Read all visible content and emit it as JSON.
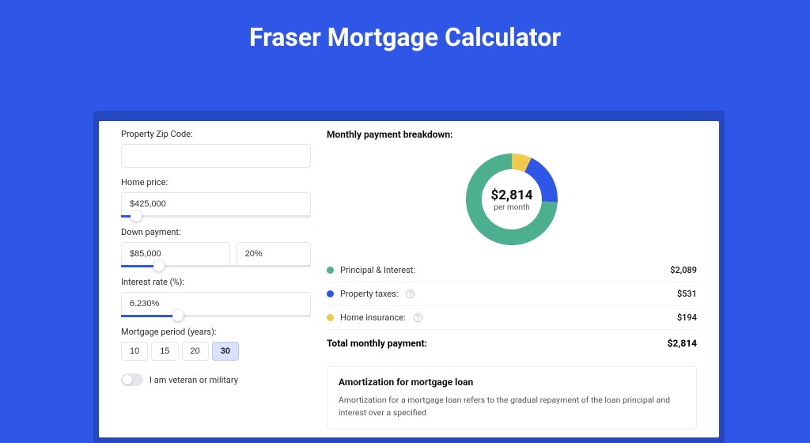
{
  "title": "Fraser Mortgage Calculator",
  "form": {
    "zip_label": "Property Zip Code:",
    "zip_value": "",
    "price_label": "Home price:",
    "price_value": "$425,000",
    "price_slider_pct": 8,
    "down_label": "Down payment:",
    "down_value": "$85,000",
    "down_pct_value": "20%",
    "down_slider_pct": 20,
    "rate_label": "Interest rate (%):",
    "rate_value": "6.230%",
    "rate_slider_pct": 30,
    "period_label": "Mortgage period (years):",
    "periods": [
      "10",
      "15",
      "20",
      "30"
    ],
    "period_active_index": 3,
    "veteran_label": "I am veteran or military",
    "veteran_on": false
  },
  "breakdown": {
    "heading": "Monthly payment breakdown:",
    "center_value": "$2,814",
    "center_sub": "per month",
    "items": [
      {
        "label": "Principal & Interest:",
        "color": "#4caf8f",
        "value": "$2,089",
        "pct": 74,
        "info": false
      },
      {
        "label": "Property taxes:",
        "color": "#2f57e7",
        "value": "$531",
        "pct": 19,
        "info": true
      },
      {
        "label": "Home insurance:",
        "color": "#f2c94c",
        "value": "$194",
        "pct": 7,
        "info": true
      }
    ],
    "total_label": "Total monthly payment:",
    "total_value": "$2,814"
  },
  "amort": {
    "heading": "Amortization for mortgage loan",
    "text": "Amortization for a mortgage loan refers to the gradual repayment of the loan principal and interest over a specified"
  },
  "chart_data": {
    "type": "pie",
    "title": "Monthly payment breakdown",
    "series": [
      {
        "name": "Principal & Interest",
        "value": 2089,
        "color": "#4caf8f"
      },
      {
        "name": "Property taxes",
        "value": 531,
        "color": "#2f57e7"
      },
      {
        "name": "Home insurance",
        "value": 194,
        "color": "#f2c94c"
      }
    ],
    "total": 2814,
    "center_label": "$2,814 per month"
  }
}
